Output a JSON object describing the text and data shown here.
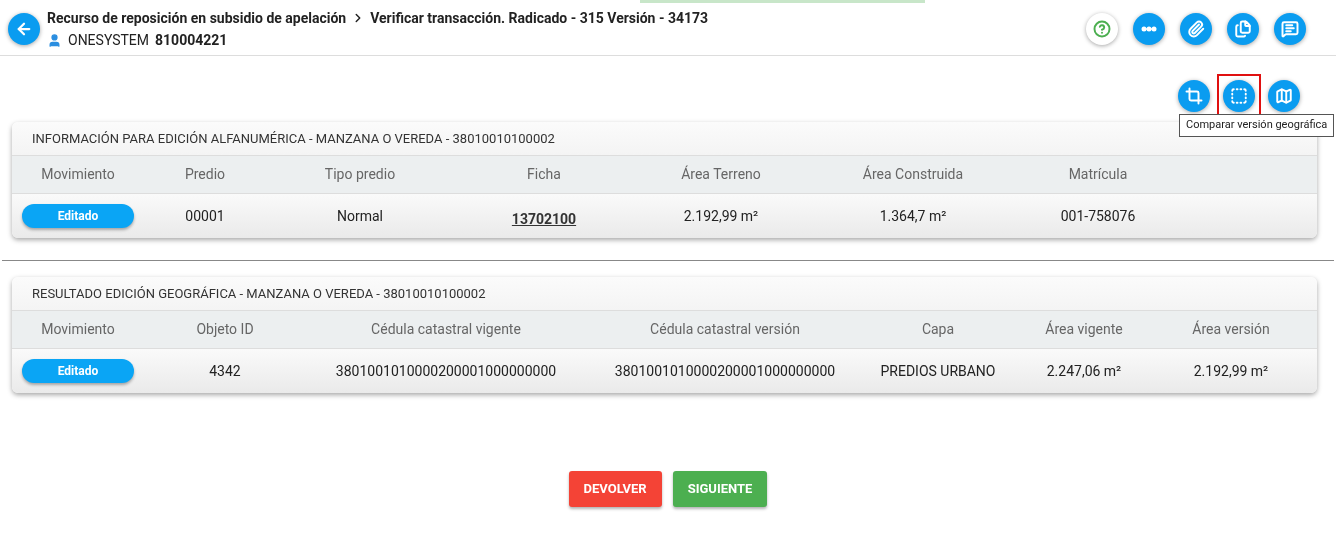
{
  "header": {
    "breadcrumb": [
      "Recurso de reposición en subsidio de apelación",
      "Verificar transacción. Radicado - 315 Versión - 34173"
    ],
    "user": "ONESYSTEM",
    "user_id": "810004221"
  },
  "header_actions": [
    {
      "kind": "help"
    },
    {
      "kind": "flow"
    },
    {
      "kind": "attach"
    },
    {
      "kind": "copy"
    },
    {
      "kind": "notes"
    }
  ],
  "tools": [
    {
      "kind": "crop",
      "highlighted": false
    },
    {
      "kind": "compare",
      "highlighted": true,
      "tooltip": "Comparar versión geográfica"
    },
    {
      "kind": "map",
      "highlighted": false
    }
  ],
  "sections": [
    {
      "title": "INFORMACIÓN PARA EDICIÓN ALFANUMÉRICA - MANZANA O VEREDA - 38010010100002",
      "kind": "alpha",
      "columns": [
        "Movimiento",
        "Predio",
        "Tipo predio",
        "Ficha",
        "Área Terreno",
        "Área Construida",
        "Matrícula"
      ],
      "rows": [
        [
          {
            "kind": "badge",
            "text": "Editado"
          },
          {
            "kind": "text",
            "text": "00001"
          },
          {
            "kind": "text",
            "text": "Normal"
          },
          {
            "kind": "link",
            "text": "13702100"
          },
          {
            "kind": "text",
            "text": "2.192,99 m²"
          },
          {
            "kind": "text",
            "text": "1.364,7 m²"
          },
          {
            "kind": "text",
            "text": "001-758076"
          }
        ]
      ]
    },
    {
      "title": "RESULTADO EDICIÓN GEOGRÁFICA - MANZANA O VEREDA - 38010010100002",
      "kind": "geo",
      "columns": [
        "Movimiento",
        "Objeto ID",
        "Cédula catastral vigente",
        "Cédula catastral versión",
        "Capa",
        "Área vigente",
        "Área versión"
      ],
      "rows": [
        [
          {
            "kind": "badge",
            "text": "Editado"
          },
          {
            "kind": "text",
            "text": "4342"
          },
          {
            "kind": "text",
            "text": "3801001010000200001000000000"
          },
          {
            "kind": "text",
            "text": "3801001010000200001000000000"
          },
          {
            "kind": "text",
            "text": "PREDIOS URBANO"
          },
          {
            "kind": "text",
            "text": "2.247,06 m²"
          },
          {
            "kind": "text",
            "text": "2.192,99 m²"
          }
        ]
      ]
    }
  ],
  "buttons": [
    {
      "kind": "danger",
      "label": "DEVOLVER"
    },
    {
      "kind": "success",
      "label": "SIGUIENTE"
    }
  ]
}
